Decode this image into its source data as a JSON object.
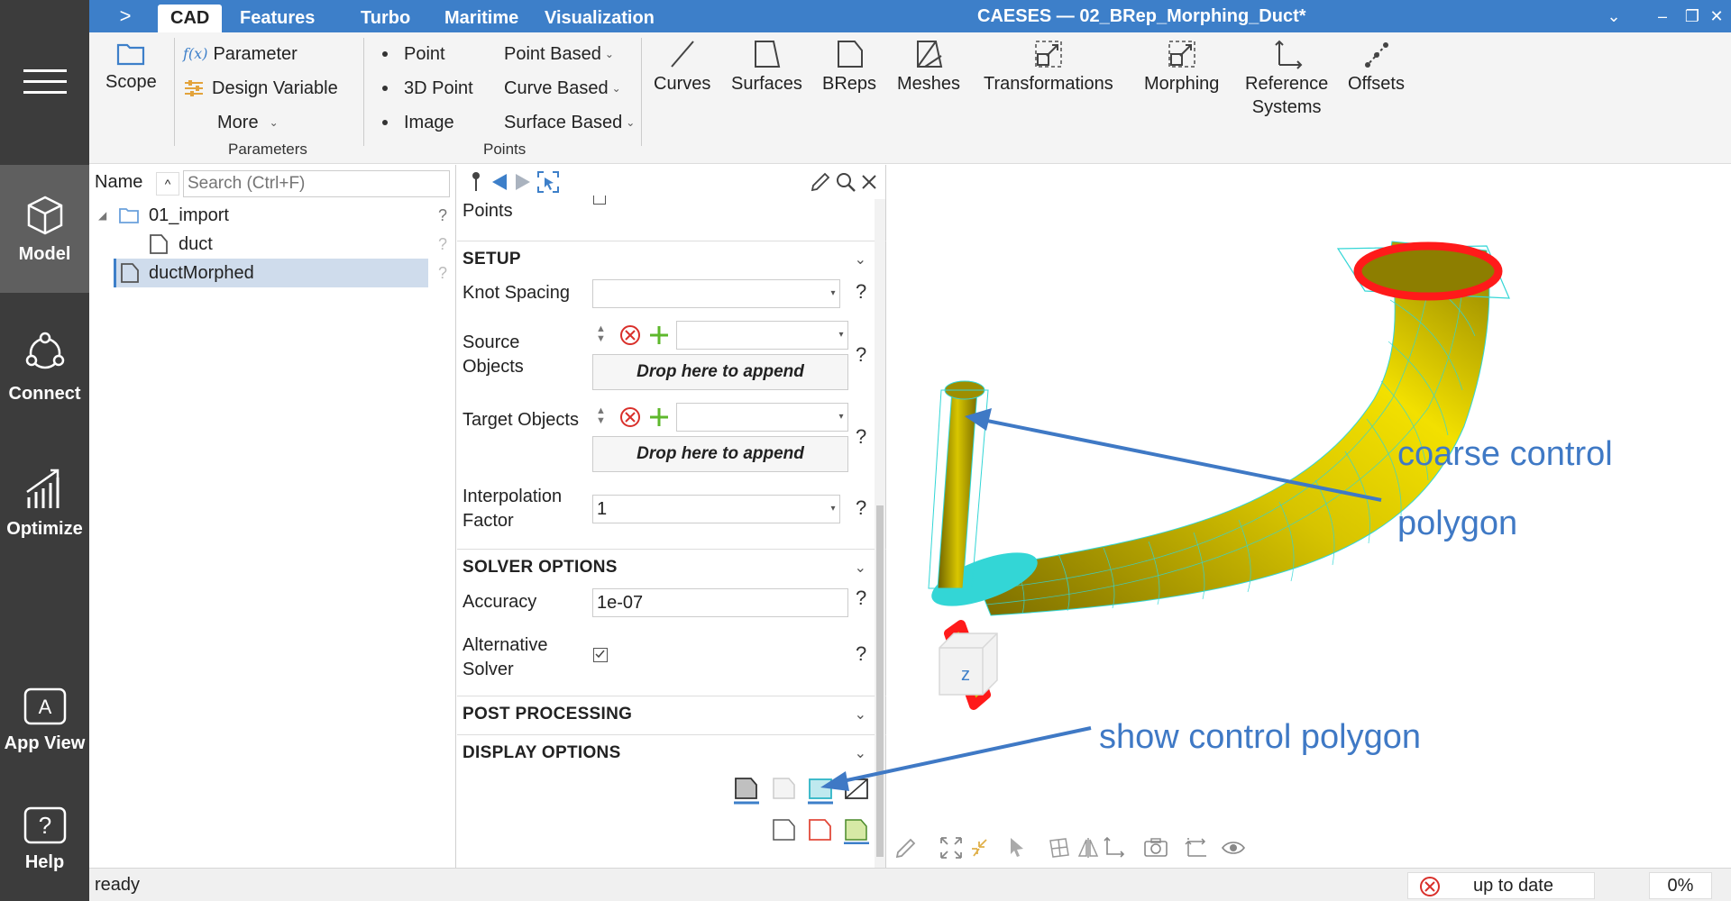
{
  "app": {
    "window_title": "CAESES — 02_BRep_Morphing_Duct*",
    "ribbon_toggle": ">",
    "tabs": [
      "CAD",
      "Features",
      "Turbo",
      "Maritime",
      "Visualization"
    ],
    "active_tab": "CAD"
  },
  "rail": {
    "items": [
      {
        "label": "Model",
        "icon": "cube-icon"
      },
      {
        "label": "Connect",
        "icon": "connect-icon"
      },
      {
        "label": "Optimize",
        "icon": "optimize-icon"
      },
      {
        "label": "App View",
        "icon": "app-view-icon"
      },
      {
        "label": "Help",
        "icon": "help-icon"
      }
    ]
  },
  "ribbon": {
    "scope": "Scope",
    "parameter": "Parameter",
    "parameter_prefix": "f(x)",
    "design_variable": "Design Variable",
    "more": "More",
    "parameters_group": "Parameters",
    "point": "Point",
    "point3d": "3D Point",
    "image": "Image",
    "point_based": "Point Based",
    "curve_based": "Curve Based",
    "surface_based": "Surface Based",
    "points_group": "Points",
    "curves": "Curves",
    "surfaces": "Surfaces",
    "breps": "BReps",
    "meshes": "Meshes",
    "transformations": "Transformations",
    "morphing": "Morphing",
    "reference_systems_1": "Reference",
    "reference_systems_2": "Systems",
    "offsets": "Offsets"
  },
  "tree": {
    "name_header": "Name",
    "search_placeholder": "Search (Ctrl+F)",
    "rows": [
      {
        "label": "01_import",
        "help": "?"
      },
      {
        "label": "duct",
        "help": "?"
      },
      {
        "label": "ductMorphed",
        "help": "?"
      }
    ]
  },
  "props": {
    "top_row_label": "Points",
    "setup_title": "SETUP",
    "knot_spacing": "Knot Spacing",
    "source_objects_1": "Source",
    "source_objects_2": "Objects",
    "target_objects": "Target Objects",
    "drop_here": "Drop here to append",
    "interp_1": "Interpolation",
    "interp_2": "Factor",
    "interp_value": "1",
    "solver_title": "SOLVER OPTIONS",
    "accuracy": "Accuracy",
    "accuracy_value": "1e-07",
    "alt_solver_1": "Alternative",
    "alt_solver_2": "Solver",
    "post_title": "POST PROCESSING",
    "display_title": "DISPLAY OPTIONS",
    "help": "?"
  },
  "viewport": {
    "annotation_1a": "coarse control",
    "annotation_1b": "polygon",
    "annotation_2": "show control polygon",
    "nav_cube_label": "z",
    "annotation_color": "#3f79c5",
    "surface_color": "#c9b800",
    "mesh_color": "#33d6d6",
    "highlight_color": "#ff1a1a"
  },
  "status": {
    "text": "ready",
    "build_state": "up to date",
    "progress": "0%"
  }
}
